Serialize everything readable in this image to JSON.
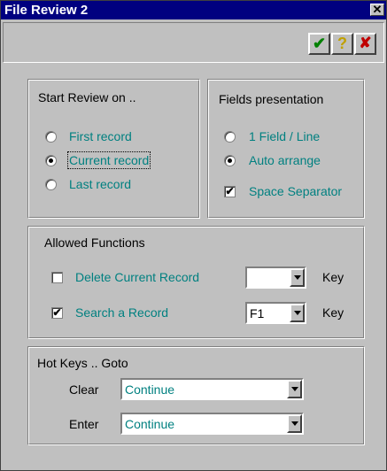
{
  "window": {
    "title": "File Review 2",
    "close_label": "✕"
  },
  "toolbar": {
    "ok_icon": "check-icon",
    "help_icon": "question-icon",
    "cancel_icon": "x-icon",
    "ok_glyph": "✔",
    "help_glyph": "?",
    "cancel_glyph": "✘"
  },
  "start_review": {
    "title": "Start Review on ..",
    "options": [
      "First record",
      "Current record",
      "Last record"
    ],
    "selected": "Current record"
  },
  "fields_presentation": {
    "title": "Fields presentation",
    "options": [
      "1 Field /  Line",
      "Auto arrange"
    ],
    "selected": "Auto arrange",
    "space_separator_label": "Space Separator",
    "space_separator_checked": true
  },
  "allowed_functions": {
    "title": "Allowed Functions",
    "delete_label": "Delete Current Record",
    "delete_checked": false,
    "delete_key": "",
    "search_label": "Search a Record",
    "search_checked": true,
    "search_key": "F1",
    "key_label": "Key"
  },
  "hot_keys": {
    "title": "Hot Keys .. Goto",
    "clear_label": "Clear",
    "clear_value": "Continue",
    "enter_label": "Enter",
    "enter_value": "Continue"
  },
  "colors": {
    "title_bar": "#000080",
    "face": "#c0c0c0",
    "option_text": "#008080"
  }
}
